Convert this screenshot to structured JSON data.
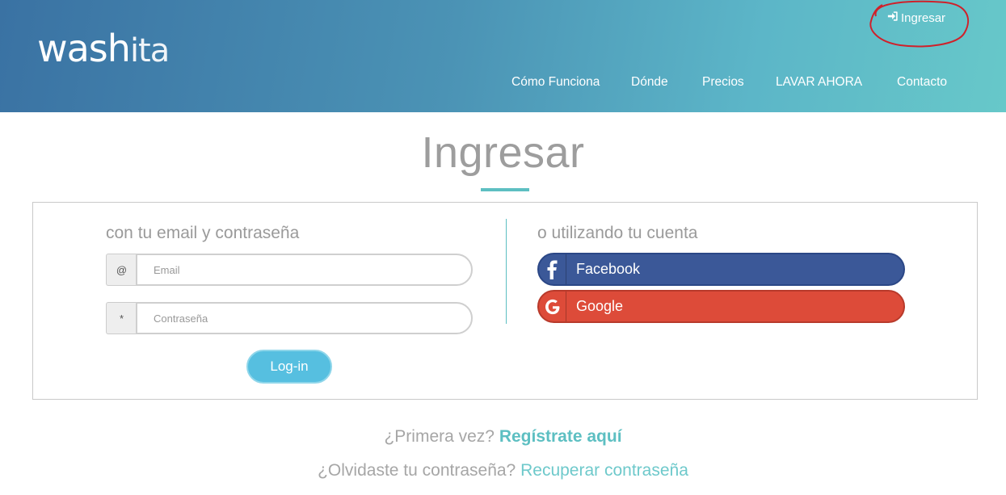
{
  "header": {
    "logo_main": "wash",
    "logo_light": "ita",
    "login_link": "Ingresar",
    "nav": [
      "Cómo Funciona",
      "Dónde",
      "Precios",
      "LAVAR AHORA",
      "Contacto"
    ]
  },
  "page": {
    "title": "Ingresar"
  },
  "email_login": {
    "heading": "con tu email y contraseña",
    "email_addon": "@",
    "email_placeholder": "Email",
    "password_addon": "*",
    "password_placeholder": "Contraseña",
    "submit_label": "Log-in"
  },
  "social_login": {
    "heading": "o utilizando tu cuenta",
    "facebook_label": "Facebook",
    "google_label": "Google"
  },
  "footer": {
    "first_time_text": "¿Primera vez?",
    "register_link": "Regístrate aquí",
    "forgot_text": "¿Olvidaste tu contraseña?",
    "recover_link": "Recuperar contraseña"
  },
  "colors": {
    "accent": "#5dbfc2",
    "facebook": "#3b5898",
    "google": "#dd4b39",
    "login_button": "#56bfe0"
  },
  "icons": {
    "login": "sign-in-icon",
    "facebook": "facebook-icon",
    "google": "google-icon"
  }
}
